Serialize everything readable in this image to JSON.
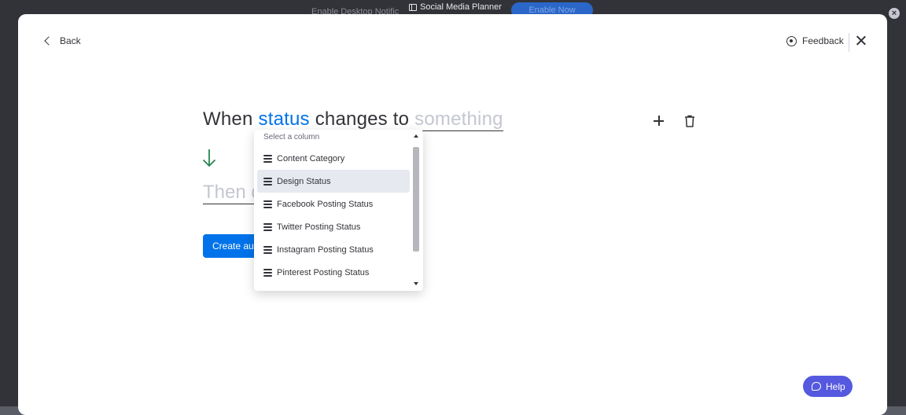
{
  "app": {
    "window_title": "Social Media Planner",
    "top_hint": "Enable Desktop Notific",
    "top_button": "Enable Now"
  },
  "header": {
    "back_label": "Back",
    "feedback_label": "Feedback"
  },
  "trigger": {
    "prefix": "When",
    "column_keyword": "status",
    "middle": "changes to",
    "value_placeholder": "something"
  },
  "action": {
    "placeholder": "Then do"
  },
  "create_button": "Create au",
  "dropdown": {
    "header": "Select a column",
    "items": [
      {
        "label": "Content Category"
      },
      {
        "label": "Design Status"
      },
      {
        "label": "Facebook Posting Status"
      },
      {
        "label": "Twitter Posting Status"
      },
      {
        "label": "Instagram Posting Status"
      },
      {
        "label": "Pinterest Posting Status"
      }
    ],
    "hovered_item": "Design Status"
  },
  "help_label": "Help",
  "colors": {
    "accent": "#0073ea",
    "help": "#5559df",
    "arrow": "#258750",
    "text": "#323338",
    "placeholder": "#c5c7d0"
  },
  "icons": [
    "chevron-left-icon",
    "feedback-icon",
    "close-icon",
    "plus-icon",
    "trash-icon",
    "arrow-down-icon",
    "status-column-icon",
    "help-icon"
  ]
}
